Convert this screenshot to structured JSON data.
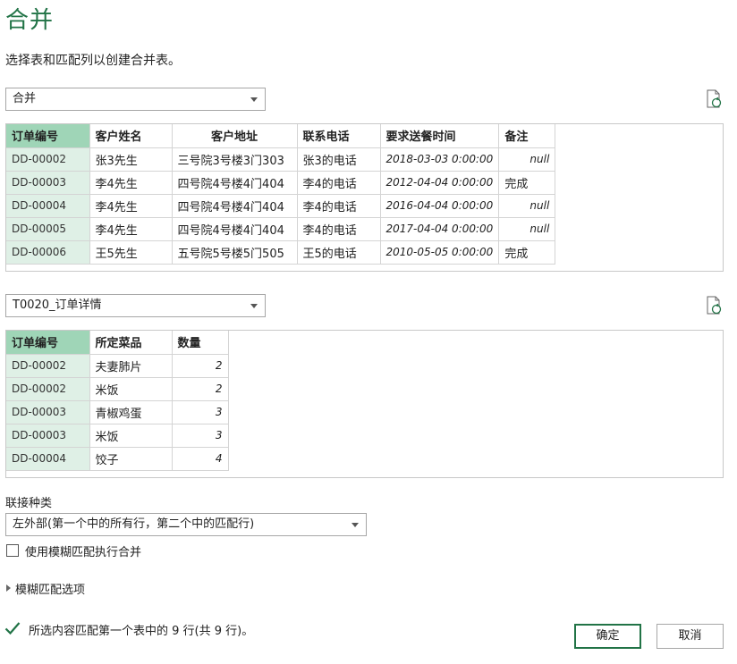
{
  "dialog": {
    "title": "合并",
    "subtitle": "选择表和匹配列以创建合并表。"
  },
  "table1": {
    "selected": "合并",
    "headers": [
      "订单编号",
      "客户姓名",
      "客户地址",
      "联系电话",
      "要求送餐时间",
      "备注"
    ],
    "rows": [
      [
        "DD-00002",
        "张3先生",
        "三号院3号楼3门303",
        "张3的电话",
        "2018-03-03 0:00:00",
        "null"
      ],
      [
        "DD-00003",
        "李4先生",
        "四号院4号楼4门404",
        "李4的电话",
        "2012-04-04 0:00:00",
        "完成"
      ],
      [
        "DD-00004",
        "李4先生",
        "四号院4号楼4门404",
        "李4的电话",
        "2016-04-04 0:00:00",
        "null"
      ],
      [
        "DD-00005",
        "李4先生",
        "四号院4号楼4门404",
        "李4的电话",
        "2017-04-04 0:00:00",
        "null"
      ],
      [
        "DD-00006",
        "王5先生",
        "五号院5号楼5门505",
        "王5的电话",
        "2010-05-05 0:00:00",
        "完成"
      ]
    ]
  },
  "table2": {
    "selected": "T0020_订单详情",
    "headers": [
      "订单编号",
      "所定菜品",
      "数量"
    ],
    "rows": [
      [
        "DD-00002",
        "夫妻肺片",
        "2"
      ],
      [
        "DD-00002",
        "米饭",
        "2"
      ],
      [
        "DD-00003",
        "青椒鸡蛋",
        "3"
      ],
      [
        "DD-00003",
        "米饭",
        "3"
      ],
      [
        "DD-00004",
        "饺子",
        "4"
      ]
    ]
  },
  "join": {
    "label": "联接种类",
    "selected": "左外部(第一个中的所有行，第二个中的匹配行)"
  },
  "fuzzy": {
    "checkbox_label": "使用模糊匹配执行合并",
    "checked": false,
    "options_label": "模糊匹配选项"
  },
  "status": {
    "text": "所选内容匹配第一个表中的 9 行(共 9 行)。"
  },
  "buttons": {
    "ok": "确定",
    "cancel": "取消"
  },
  "colors": {
    "accent": "#217346",
    "key_header": "#9fd5b7",
    "key_cell": "#dff0e6"
  }
}
